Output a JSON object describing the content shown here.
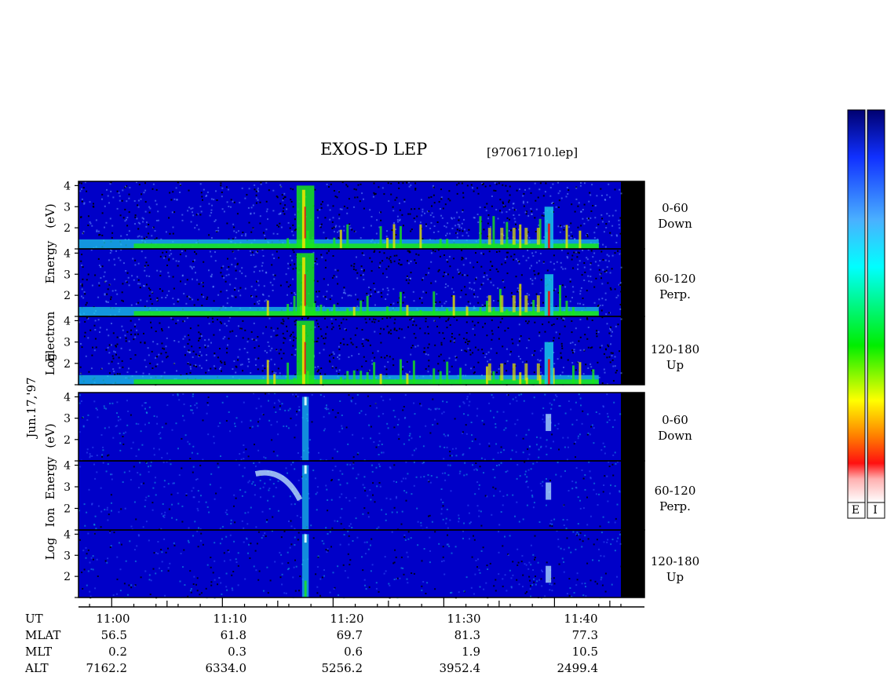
{
  "header": {
    "title": "EXOS-D LEP",
    "file": "[97061710.lep]"
  },
  "date_label": "Jun.17,'97",
  "electron_ylabel": [
    "Electron",
    "Energy",
    "(eV)",
    "Log"
  ],
  "ion_ylabel": [
    "Ion",
    "Energy",
    "(eV)",
    "Log"
  ],
  "panels": [
    {
      "id": "e1",
      "group": "electron",
      "line1": "0-60",
      "line2": "Down"
    },
    {
      "id": "e2",
      "group": "electron",
      "line1": "60-120",
      "line2": "Perp."
    },
    {
      "id": "e3",
      "group": "electron",
      "line1": "120-180",
      "line2": "Up"
    },
    {
      "id": "i1",
      "group": "ion",
      "line1": "0-60",
      "line2": "Down"
    },
    {
      "id": "i2",
      "group": "ion",
      "line1": "60-120",
      "line2": "Perp."
    },
    {
      "id": "i3",
      "group": "ion",
      "line1": "120-180",
      "line2": "Up"
    }
  ],
  "colors": {
    "background": "#0000c8",
    "noise_black": "#000000",
    "green": "#19e619",
    "cyan": "#19c8e6",
    "yellow": "#e6e600",
    "red": "#e61919",
    "light_blue": "#6ea0ff"
  },
  "colorbars": {
    "labels": [
      "E",
      "I"
    ],
    "stops": [
      "#ffffff",
      "#ff9a9a",
      "#ff0000",
      "#ff8000",
      "#ffff00",
      "#00ff00",
      "#00ffff",
      "#4aa8ff",
      "#0000ff",
      "#000080"
    ]
  },
  "chart_data": {
    "type": "heatmap",
    "title": "EXOS-D LEP",
    "subtitle": "[97061710.lep]",
    "xlabel": "UT",
    "x_ticks": [
      "11:00",
      "11:10",
      "11:20",
      "11:30",
      "11:40"
    ],
    "x_range_min": [
      -3,
      46
    ],
    "y_ticks": [
      "1",
      "2",
      "3",
      "4"
    ],
    "ylim": [
      1,
      4.2
    ],
    "ylabel_electron": "Log Electron Energy (eV)",
    "ylabel_ion": "Log Ion Energy (eV)",
    "panels": [
      {
        "species": "Electron",
        "pitch": "0-60",
        "dir": "Down"
      },
      {
        "species": "Electron",
        "pitch": "60-120",
        "dir": "Perp."
      },
      {
        "species": "Electron",
        "pitch": "120-180",
        "dir": "Up"
      },
      {
        "species": "Ion",
        "pitch": "0-60",
        "dir": "Down"
      },
      {
        "species": "Ion",
        "pitch": "60-120",
        "dir": "Perp."
      },
      {
        "species": "Ion",
        "pitch": "120-180",
        "dir": "Up"
      }
    ],
    "features": [
      {
        "panel": "electron",
        "type": "low-energy band",
        "t_start": -3,
        "t_end": 44,
        "energy": 1.2
      },
      {
        "panel": "electron",
        "type": "burst",
        "t": 17.5,
        "energy_max": 4.0
      },
      {
        "panel": "electron",
        "type": "burst",
        "t": 39.5,
        "energy_max": 3.0
      },
      {
        "panel": "ion",
        "type": "dispersed burst",
        "t": 17.5,
        "energy_max": 4.0
      },
      {
        "panel": "ion",
        "type": "arc",
        "t_start": 13,
        "t_end": 17,
        "energy": 3.6
      },
      {
        "panel": "ion",
        "type": "burst",
        "t": 39.5,
        "energy_max": 3.2
      }
    ],
    "ephemeris": {
      "rows": [
        "UT",
        "MLAT",
        "MLT",
        "ALT"
      ],
      "MLAT": [
        "56.5",
        "61.8",
        "69.7",
        "81.3",
        "77.3"
      ],
      "MLT": [
        "0.2",
        "0.3",
        "0.6",
        "1.9",
        "10.5"
      ],
      "ALT": [
        "7162.2",
        "6334.0",
        "5256.2",
        "3952.4",
        "2499.4"
      ]
    }
  }
}
